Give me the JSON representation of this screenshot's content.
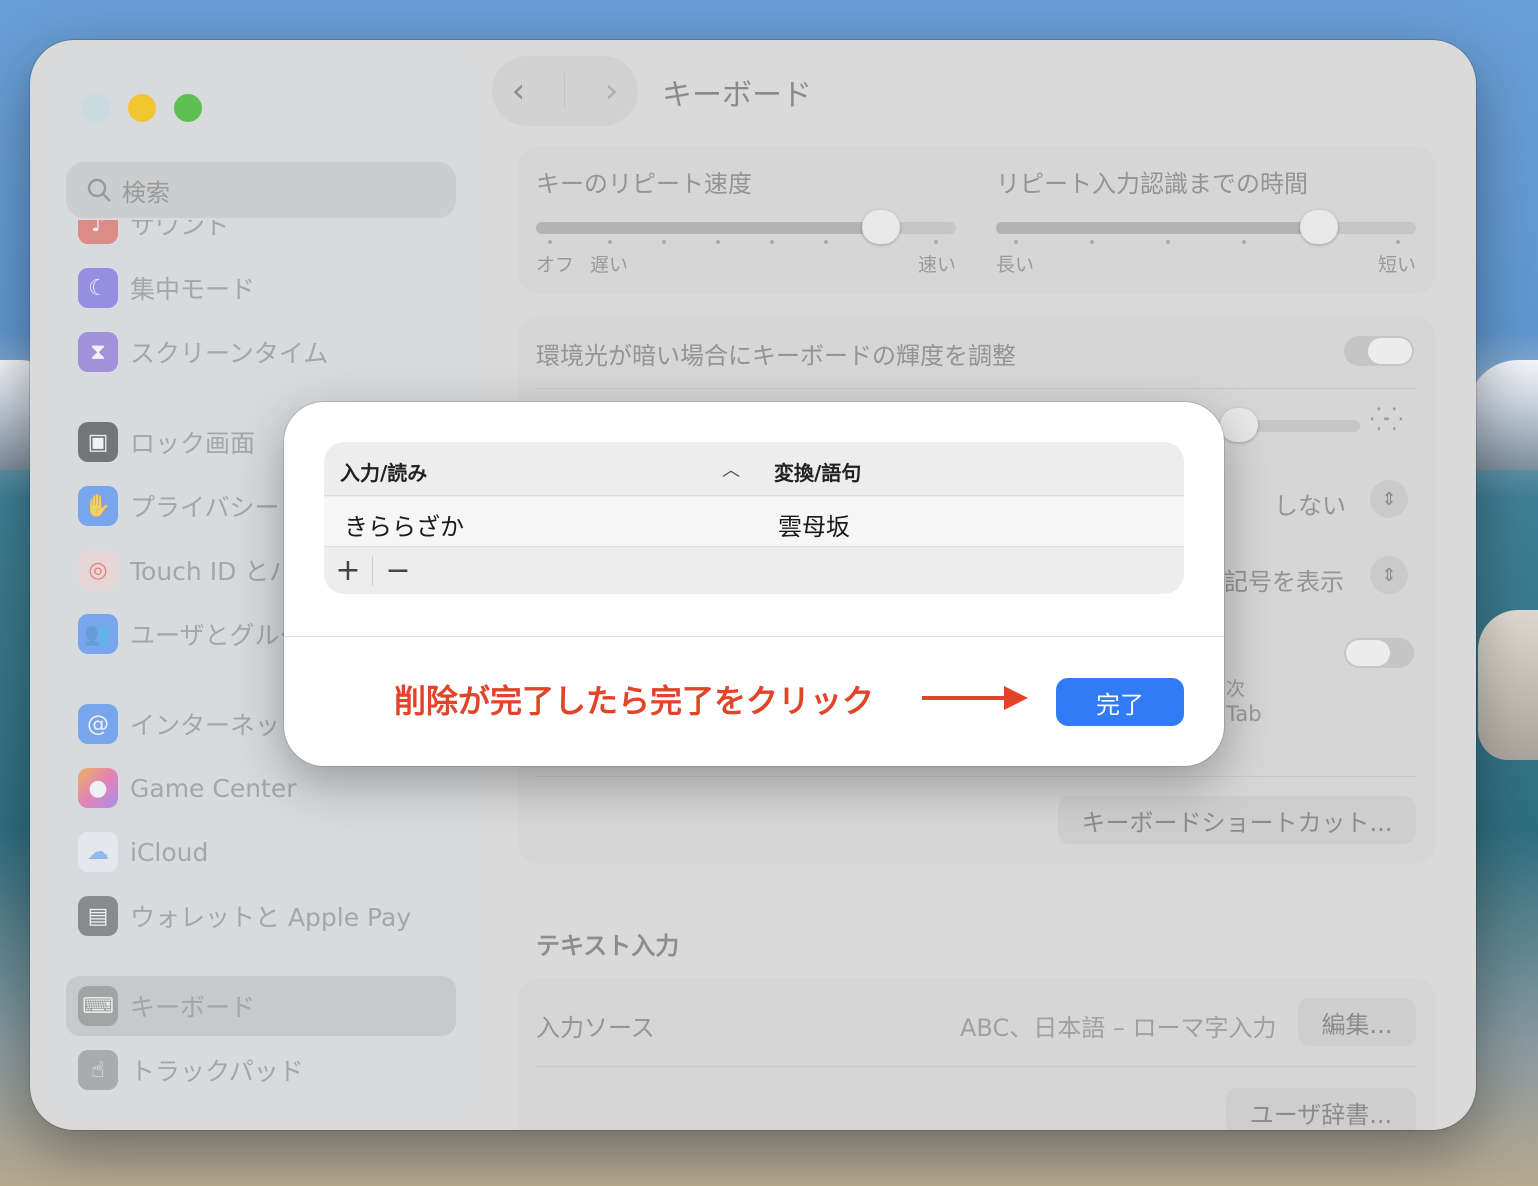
{
  "window": {
    "title": "キーボード"
  },
  "sidebar": {
    "search_placeholder": "検索",
    "items": [
      {
        "label": "サウンド",
        "icon": "speaker-icon",
        "color": "#e2574c"
      },
      {
        "label": "集中モード",
        "icon": "moon-icon",
        "color": "#6c5ce7"
      },
      {
        "label": "スクリーンタイム",
        "icon": "hourglass-icon",
        "color": "#7b61d8"
      },
      {
        "label": "ロック画面",
        "icon": "lock-icon",
        "color": "#333333"
      },
      {
        "label": "プライバシーと",
        "icon": "hand-icon",
        "color": "#3b82f6"
      },
      {
        "label": "Touch ID とパ",
        "icon": "fingerprint-icon",
        "color": "#ef4444"
      },
      {
        "label": "ユーザとグルー",
        "icon": "users-icon",
        "color": "#3b82f6"
      },
      {
        "label": "インターネット",
        "icon": "at-icon",
        "color": "#3b82f6"
      },
      {
        "label": "Game Center",
        "icon": "game-center-icon",
        "color": "#f59e0b"
      },
      {
        "label": "iCloud",
        "icon": "cloud-icon",
        "color": "#60a5fa"
      },
      {
        "label": "ウォレットと Apple Pay",
        "icon": "wallet-icon",
        "color": "#555555"
      },
      {
        "label": "キーボード",
        "icon": "keyboard-icon",
        "color": "#777777",
        "selected": true
      },
      {
        "label": "トラックパッド",
        "icon": "trackpad-icon",
        "color": "#777777"
      }
    ]
  },
  "settings": {
    "key_repeat_label": "キーのリピート速度",
    "key_repeat_left1": "オフ",
    "key_repeat_left2": "遅い",
    "key_repeat_right": "速い",
    "key_repeat_value": 0.82,
    "delay_label": "リピート入力認識までの時間",
    "delay_left": "長い",
    "delay_right": "短い",
    "delay_value": 0.77,
    "backlight_label": "環境光が暗い場合にキーボードの輝度を調整",
    "shinai": "しない",
    "kigou": "記号を表示",
    "next_label": "次",
    "tab_label": "Tab",
    "shortcut_button": "キーボードショートカット...",
    "text_input_header": "テキスト入力",
    "input_source_label": "入力ソース",
    "input_source_value": "ABC、日本語 – ローマ字入力",
    "edit_button": "編集...",
    "user_dict_button": "ユーザ辞書..."
  },
  "dialog": {
    "col_input": "入力/読み",
    "col_phrase": "変換/語句",
    "row_input": "きららざか",
    "row_phrase": "雲母坂",
    "add_label": "+",
    "remove_label": "−",
    "annotation": "削除が完了したら完了をクリック",
    "done_button": "完了",
    "accent": "#2f7cf6",
    "annotation_color": "#e2442a"
  }
}
